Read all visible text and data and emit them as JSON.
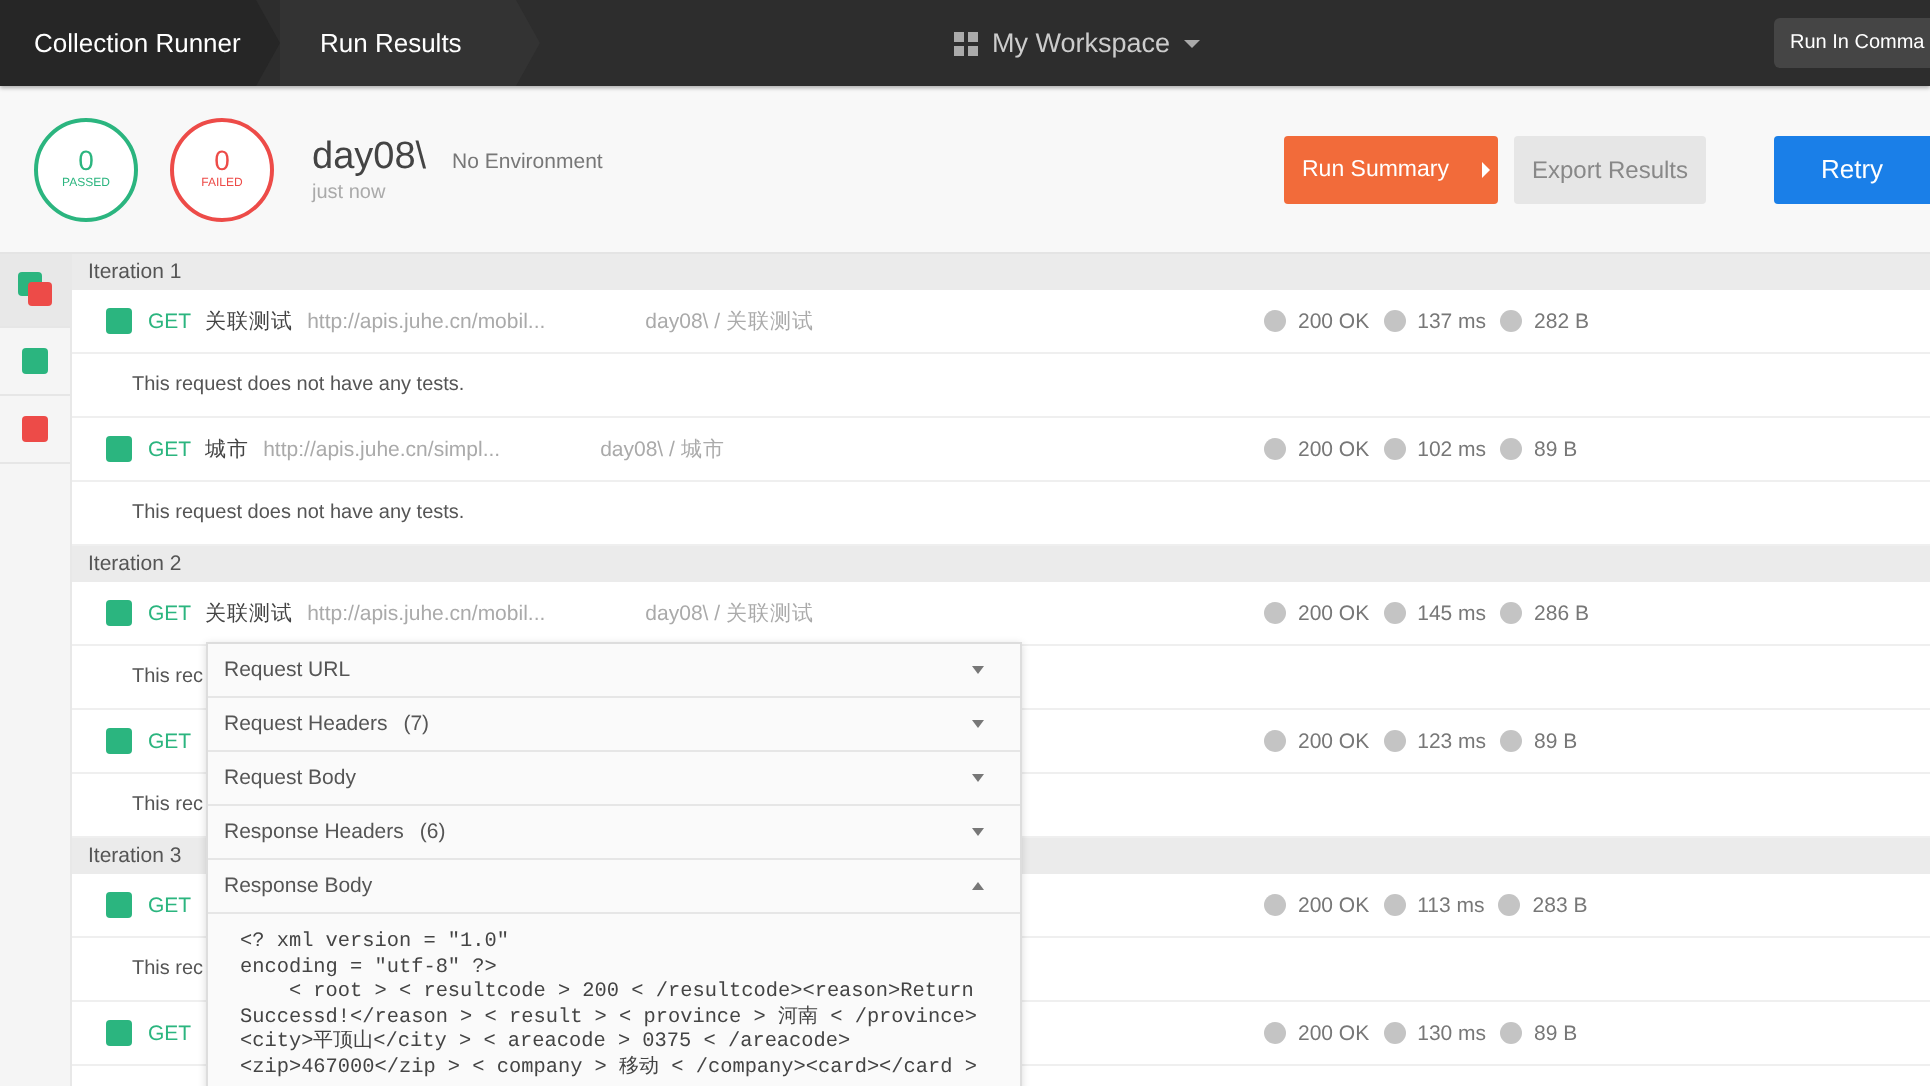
{
  "topbar": {
    "tabs": [
      {
        "label": "Collection Runner",
        "selected": false
      },
      {
        "label": "Run Results",
        "selected": true
      }
    ],
    "workspace": "My Workspace",
    "command_button": "Run In Comma"
  },
  "summary": {
    "passed": {
      "count": "0",
      "label": "PASSED"
    },
    "failed": {
      "count": "0",
      "label": "FAILED"
    },
    "collection": "day08\\",
    "environment": "No Environment",
    "time": "just now",
    "run_summary": "Run Summary",
    "export": "Export Results",
    "retry": "Retry"
  },
  "sidebar": {
    "items": [
      {
        "kind": "mixed",
        "selected": true
      },
      {
        "kind": "pass",
        "selected": false
      },
      {
        "kind": "fail",
        "selected": false
      }
    ]
  },
  "iterations": [
    {
      "title": "Iteration 1",
      "rows": [
        {
          "kind": "request",
          "method": "GET",
          "name": "关联测试",
          "url": "http://apis.juhe.cn/mobil...",
          "path": "day08\\ / 关联测试",
          "code": "200 OK",
          "time": "137 ms",
          "size": "282 B"
        },
        {
          "kind": "note",
          "text": "This request does not have any tests."
        },
        {
          "kind": "request",
          "method": "GET",
          "name": "城市",
          "url": "http://apis.juhe.cn/simpl...",
          "path": "day08\\ / 城市",
          "code": "200 OK",
          "time": "102 ms",
          "size": "89 B"
        },
        {
          "kind": "note",
          "text": "This request does not have any tests."
        }
      ]
    },
    {
      "title": "Iteration 2",
      "rows": [
        {
          "kind": "request",
          "method": "GET",
          "name": "关联测试",
          "url": "http://apis.juhe.cn/mobil...",
          "path": "day08\\ / 关联测试",
          "code": "200 OK",
          "time": "145 ms",
          "size": "286 B"
        },
        {
          "kind": "note",
          "text": "This rec"
        },
        {
          "kind": "request",
          "method": "GET",
          "code": "200 OK",
          "time": "123 ms",
          "size": "89 B"
        },
        {
          "kind": "note",
          "text": "This rec"
        }
      ]
    },
    {
      "title": "Iteration 3",
      "rows": [
        {
          "kind": "request",
          "method": "GET",
          "code": "200 OK",
          "time": "113 ms",
          "size": "283 B"
        },
        {
          "kind": "note",
          "text": "This rec"
        },
        {
          "kind": "request",
          "method": "GET",
          "code": "200 OK",
          "time": "130 ms",
          "size": "89 B"
        }
      ]
    }
  ],
  "popover": {
    "sections": [
      {
        "label": "Request URL",
        "expanded": false
      },
      {
        "label": "Request Headers",
        "count": "(7)",
        "expanded": false
      },
      {
        "label": "Request Body",
        "expanded": false
      },
      {
        "label": "Response Headers",
        "count": "(6)",
        "expanded": false
      },
      {
        "label": "Response Body",
        "expanded": true,
        "body": [
          "<? xml version = \"1.0\"",
          "encoding = \"utf-8\" ?>",
          "    < root > < resultcode > 200 < /resultcode><reason>Return",
          "Successd!</reason > < result > < province > 河南 < /province>",
          "<city>平顶山</city > < areacode > 0375 < /areacode>",
          "<zip>467000</zip > < company > 移动 < /company><card></card >"
        ]
      }
    ]
  }
}
